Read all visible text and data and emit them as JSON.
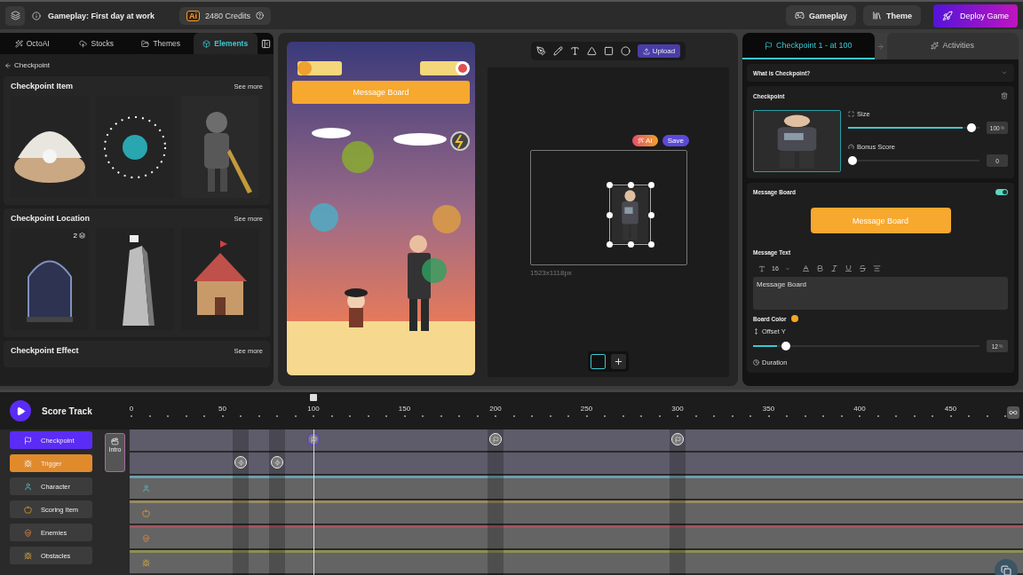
{
  "topbar": {
    "title": "Gameplay: First day at work",
    "ai_logo": "Ai",
    "credits": "2480 Credits",
    "buttons": [
      {
        "kind": "gameplay",
        "label": "Gameplay"
      },
      {
        "kind": "theme",
        "label": "Theme"
      }
    ],
    "deploy": "Deploy Game"
  },
  "left_panel": {
    "tabs": [
      {
        "kind": "ai",
        "label": "OctoAI",
        "selected": false
      },
      {
        "kind": "stocks",
        "label": "Stocks",
        "selected": false
      },
      {
        "kind": "themes",
        "label": "Themes",
        "selected": false
      },
      {
        "kind": "elements",
        "label": "Elements",
        "selected": true
      }
    ],
    "back": "Checkpoint",
    "sections": [
      {
        "title": "Checkpoint Item",
        "see_more": "See more",
        "items": [
          {
            "kind": "picture"
          },
          {
            "kind": "picture"
          },
          {
            "kind": "picture"
          }
        ]
      },
      {
        "title": "Checkpoint Location",
        "see_more": "See more",
        "items": [
          {
            "kind": "picture",
            "badge": "2"
          },
          {
            "kind": "picture"
          },
          {
            "kind": "picture"
          }
        ]
      },
      {
        "title": "Checkpoint Effect",
        "see_more": "See more"
      }
    ]
  },
  "preview": {
    "message_board": "Message Board"
  },
  "canvas": {
    "tools": [
      {
        "kind": "pen"
      },
      {
        "kind": "pencil"
      },
      {
        "kind": "text"
      },
      {
        "kind": "triangle"
      },
      {
        "kind": "square"
      },
      {
        "kind": "circle"
      }
    ],
    "upload": "Upload",
    "ai": "AI",
    "save": "Save",
    "dimensions": "1523x1118px"
  },
  "right_panel": {
    "tabs": [
      {
        "kind": "checkpoint",
        "label": "Checkpoint 1 - at 100",
        "selected": true
      },
      {
        "kind": "activities",
        "label": "Activities",
        "selected": false
      }
    ],
    "faq": "What is Checkpoint?",
    "checkpoint": {
      "title": "Checkpoint",
      "size": {
        "label": "Size",
        "level": 0.97,
        "value": "100",
        "unit": "%"
      },
      "bonus": {
        "label": "Bonus Score",
        "level": 0,
        "value": "0"
      }
    },
    "message_board": {
      "title": "Message Board",
      "on": true,
      "preview": "Message Board",
      "text_label": "Message Text",
      "font_size": "16",
      "text": "Message Board",
      "color_label": "Board Color",
      "color": "#f5a623",
      "offset": {
        "label": "Offset Y",
        "level": 0.13,
        "value": "12",
        "unit": "%"
      },
      "duration": "Duration"
    }
  },
  "timeline": {
    "title": "Score Track",
    "ticks": [
      "0",
      "50",
      "100",
      "150",
      "200",
      "250",
      "300",
      "350",
      "400",
      "450"
    ],
    "intro": "Intro",
    "tracks": [
      {
        "kind": "checkpoint",
        "label": "Checkpoint",
        "selected": true,
        "color": "#5b2cf5"
      },
      {
        "kind": "trigger",
        "label": "Trigger",
        "selected": true,
        "color": "#e08a2c"
      },
      {
        "kind": "character",
        "label": "Character",
        "selected": false,
        "color": "#6f9eac"
      },
      {
        "kind": "scoring",
        "label": "Scoring Item",
        "selected": false,
        "color": "#9a8a62"
      },
      {
        "kind": "enemies",
        "label": "Enemies",
        "selected": false,
        "color": "#a8535f"
      },
      {
        "kind": "obstacles",
        "label": "Obstacles",
        "selected": false,
        "color": "#8f8e55"
      }
    ]
  }
}
